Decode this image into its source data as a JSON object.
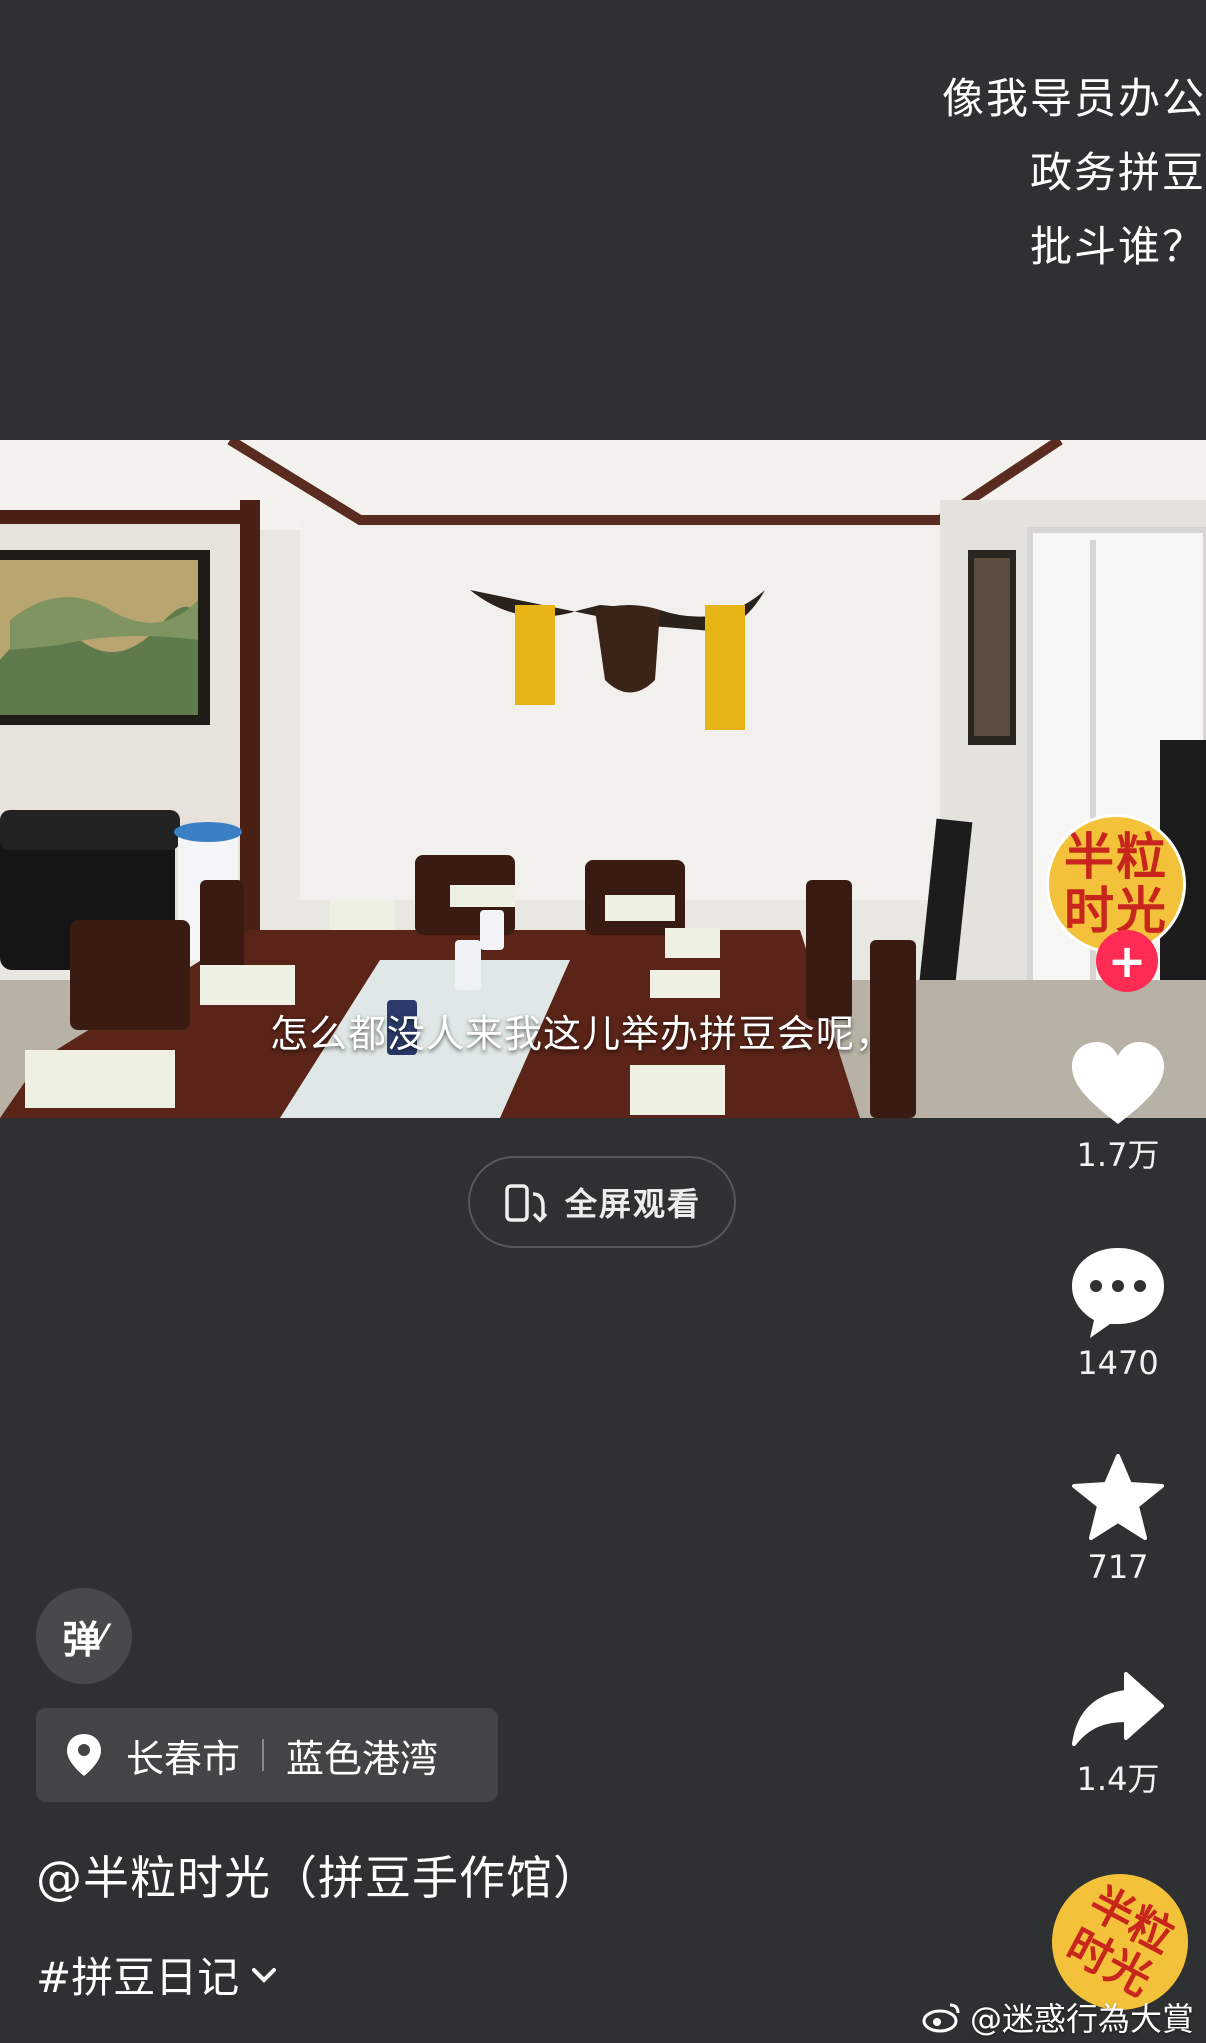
{
  "caption": {
    "lines": [
      "像我导员办公",
      "政务拼豆",
      "批斗谁？"
    ]
  },
  "video": {
    "subtitle": "怎么都没人来我这儿举办拼豆会呢，"
  },
  "fullscreen": {
    "label": "全屏观看",
    "icon": "phone-rotate-icon"
  },
  "author_avatar": {
    "text": "半粒\n时光",
    "follow_symbol": "+"
  },
  "actions": {
    "like_count": "1.7万",
    "comment_count": "1470",
    "favorite_count": "717",
    "share_count": "1.4万"
  },
  "danmu": {
    "label": "弹"
  },
  "location": {
    "city": "长春市",
    "place": "蓝色港湾"
  },
  "author": {
    "handle": "@半粒时光（拼豆手作馆）"
  },
  "hashtag": {
    "label": "#拼豆日记"
  },
  "music_disc": {
    "text": "半粒\n时光"
  },
  "watermark": {
    "text": "@迷惑行為大賞"
  },
  "colors": {
    "background": "#2f3031",
    "follow_red": "#fe2c55",
    "avatar_yellow": "#f4c23a",
    "avatar_text_red": "#c8261d"
  }
}
